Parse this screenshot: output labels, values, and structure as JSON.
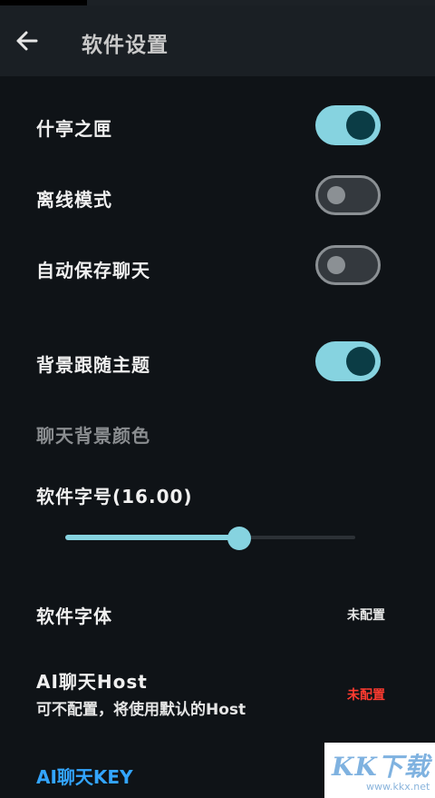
{
  "header": {
    "title": "软件设置"
  },
  "settings": {
    "shiheng": {
      "label": "什亭之匣",
      "on": true
    },
    "offline": {
      "label": "离线模式",
      "on": false
    },
    "autosave": {
      "label": "自动保存聊天",
      "on": false
    },
    "bg_follow_theme": {
      "label": "背景跟随主题",
      "on": true
    },
    "chat_bg_color": {
      "label": "聊天背景颜色"
    },
    "font_size": {
      "label": "软件字号(16.00)",
      "value": 16.0,
      "fraction": 0.6
    },
    "font": {
      "label": "软件字体",
      "value": "未配置"
    },
    "ai_host": {
      "label": "AI聊天Host",
      "sub": "可不配置，将使用默认的Host",
      "value": "未配置"
    },
    "ai_key": {
      "label": "AI聊天KEY"
    }
  },
  "colors": {
    "accent": "#86d3e0",
    "warning": "#ff3b30",
    "link": "#33a5ff"
  },
  "watermark": {
    "logo": "KK下载",
    "url": "www.kkx.net"
  }
}
